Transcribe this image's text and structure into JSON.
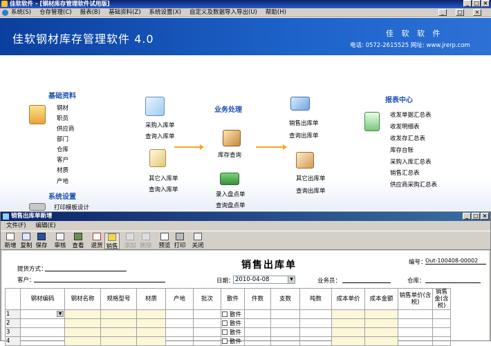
{
  "window": {
    "title": "佳软软件 - [钢材库存管理软件试用版]",
    "controls": [
      "_",
      "□",
      "×"
    ]
  },
  "menu": [
    "系统(S)",
    "仓存管理(C)",
    "报表(B)",
    "基础资料(Z)",
    "系统设置(X)",
    "自定义及数据导入导出(U)",
    "帮助(H)"
  ],
  "banner": {
    "app_title": "佳软钢材库存管理软件 4.0",
    "brand": "佳 软 软 件",
    "contact": "电话: 0572-2615525  网址: www.jrerp.com"
  },
  "desktop": {
    "basic": {
      "title": "基础资料",
      "items": [
        "钢材",
        "职员",
        "供应商",
        "部门",
        "仓库",
        "客户",
        "材质",
        "产地"
      ]
    },
    "settings": {
      "title": "系统设置",
      "items": [
        "打印模板设计"
      ]
    },
    "purchase": {
      "in": "采购入库单",
      "query": "查询入库单"
    },
    "other_in": {
      "in": "其它入库单",
      "query": "查询入库单"
    },
    "business": {
      "title": "业务处理",
      "stock_query": "库存查询",
      "count_in": "录入盘点单",
      "count_query": "查询盘点单"
    },
    "sales_out": {
      "out": "销售出库单",
      "query": "查询出库单"
    },
    "other_out": {
      "out": "其它出库单",
      "query": "查询出库单"
    },
    "reports": {
      "title": "报表中心",
      "items": [
        "收发单据汇总表",
        "收发明细表",
        "收发存汇总表",
        "库存台账",
        "采购入库汇总表",
        "销售汇总表",
        "供应商采购汇总表"
      ]
    }
  },
  "subwindow": {
    "title": "销售出库单新增",
    "menu": [
      "文件(F)",
      "编辑(E)"
    ],
    "toolbar": [
      {
        "label": "新增",
        "icon": "new-icon",
        "enabled": true
      },
      {
        "label": "复制",
        "icon": "copy-icon",
        "enabled": true
      },
      {
        "label": "保存",
        "icon": "save-icon",
        "enabled": true
      },
      {
        "label": "审核",
        "icon": "approve-icon",
        "enabled": true
      },
      {
        "label": "查看",
        "icon": "view-icon",
        "enabled": true
      },
      {
        "label": "退货",
        "icon": "return-icon",
        "enabled": true
      },
      {
        "label": "销售",
        "icon": "sales-icon",
        "enabled": true
      },
      {
        "label": "添加",
        "icon": "add-row-icon",
        "enabled": false
      },
      {
        "label": "删除",
        "icon": "delete-row-icon",
        "enabled": false
      },
      {
        "label": "预览",
        "icon": "preview-icon",
        "enabled": true
      },
      {
        "label": "打印",
        "icon": "print-icon",
        "enabled": true
      },
      {
        "label": "关闭",
        "icon": "close-icon",
        "enabled": true
      }
    ]
  },
  "form": {
    "title": "销售出库单",
    "number_label": "编号：",
    "number_value": "Out-100408-00002",
    "pickup_label": "提货方式：",
    "customer_label": "客户：",
    "date_label": "日期：",
    "date_value": "2010-04-08",
    "salesman_label": "业务员：",
    "warehouse_label": "仓库："
  },
  "table": {
    "columns": [
      "钢材编码",
      "钢材名称",
      "规格型号",
      "材质",
      "产地",
      "批次",
      "散件",
      "件数",
      "支数",
      "吨数",
      "成本单价",
      "成本金额",
      "销售单价(含税)",
      "销售金(含税)"
    ],
    "rows": [
      "1",
      "2",
      "3",
      "4"
    ],
    "bulk_label": "散件"
  },
  "colors": {
    "banner": "#1d62c9",
    "title_bar": "#0a246a",
    "section_title": "#1b4fb5",
    "arrow": "#f5a623",
    "cell_yellow": "#fbf7d8"
  }
}
